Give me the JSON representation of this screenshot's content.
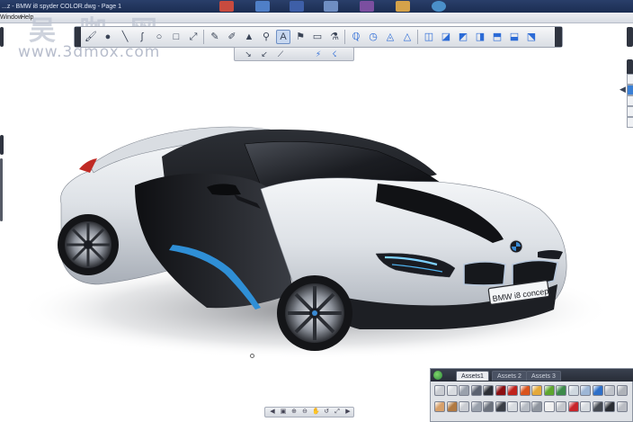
{
  "window": {
    "title": "...z - BMW i8 spyder COLOR.dwg - Page 1"
  },
  "menubar": {
    "items": [
      "Window",
      "Help"
    ]
  },
  "watermark": {
    "cn_text": "吴 咖 网",
    "url_text": "www.3dmox.com"
  },
  "toolbar": {
    "tools": [
      {
        "name": "brush-preset-icon",
        "glyph": "🖌"
      },
      {
        "name": "color-puck-icon",
        "glyph": "●"
      },
      {
        "name": "line-tool-icon",
        "glyph": "╲"
      },
      {
        "name": "curve-tool-icon",
        "glyph": "∫"
      },
      {
        "name": "ellipse-tool-icon",
        "glyph": "○"
      },
      {
        "name": "rectangle-tool-icon",
        "glyph": "□"
      },
      {
        "name": "transform-tool-icon",
        "glyph": "⤢"
      },
      {
        "name": "pencil-icon",
        "glyph": "✎"
      },
      {
        "name": "ballpoint-icon",
        "glyph": "✐"
      },
      {
        "name": "marker-icon",
        "glyph": "▲"
      },
      {
        "name": "airbrush-icon",
        "glyph": "⚲"
      },
      {
        "name": "airbrush-active-icon",
        "glyph": "A"
      },
      {
        "name": "paint-brush-icon",
        "glyph": "⚑"
      },
      {
        "name": "eraser-icon",
        "glyph": "▭"
      },
      {
        "name": "smear-icon",
        "glyph": "⚗"
      },
      {
        "name": "selection-lasso-icon",
        "glyph": "ℚ"
      },
      {
        "name": "selection-rect-icon",
        "glyph": "◷"
      },
      {
        "name": "fill-tool-icon",
        "glyph": "◬"
      },
      {
        "name": "gradient-tool-icon",
        "glyph": "△"
      },
      {
        "name": "layer-mirror-icon",
        "glyph": "◫"
      },
      {
        "name": "layer-rotate-icon",
        "glyph": "◪"
      },
      {
        "name": "layer-scale-icon",
        "glyph": "◩"
      },
      {
        "name": "layer-distort-icon",
        "glyph": "◨"
      },
      {
        "name": "perspective-icon",
        "glyph": "⬒"
      },
      {
        "name": "symmetry-icon",
        "glyph": "⬓"
      },
      {
        "name": "grid-icon",
        "glyph": "⬔"
      }
    ]
  },
  "subtoolbar": {
    "tools": [
      {
        "name": "brush-size-icon",
        "glyph": "↘"
      },
      {
        "name": "brush-opacity-icon",
        "glyph": "↙"
      },
      {
        "name": "brush-smooth-icon",
        "glyph": "⟋"
      },
      {
        "name": "stroke-fade-icon",
        "glyph": "⚡"
      },
      {
        "name": "stroke-taper-icon",
        "glyph": "☇"
      }
    ]
  },
  "car": {
    "plate_text": "BMW i8 concept"
  },
  "assets": {
    "tabs": [
      "Assets1",
      "Assets 2",
      "Assets 3"
    ],
    "active_tab": 0,
    "swatches_row1": [
      "#c9ccd2",
      "#d8dbe0",
      "#9aa1ac",
      "#5b6270",
      "#2b2e35",
      "#8b0f12",
      "#c0231d",
      "#d9541e",
      "#e4a93a",
      "#5ea62f",
      "#3d8a4a",
      "#cfd8e0",
      "#9db6d6",
      "#2e6fc8",
      "#bfc3ca",
      "#aeb2b9"
    ],
    "swatches_row2": [
      "#d7a06a",
      "#b07942",
      "#c9ccd2",
      "#9aa1ac",
      "#6c727d",
      "#3a3e46",
      "#d7dbe0",
      "#b7bcc4",
      "#90969f",
      "#f0f0f0",
      "#c4c7cc",
      "#c7252a",
      "#d7dbe0",
      "#454951",
      "#2a2d33",
      "#b9bcc3"
    ]
  },
  "statusbar": {
    "buttons": [
      "◀",
      "▣",
      "⊕",
      "⊖",
      "✋",
      "↺",
      "⤢",
      "▶"
    ]
  },
  "colors": {
    "toolbar_bg": "#e5e8ed",
    "taskbar": "#1f3358",
    "accent_blue": "#2f8fd6"
  }
}
